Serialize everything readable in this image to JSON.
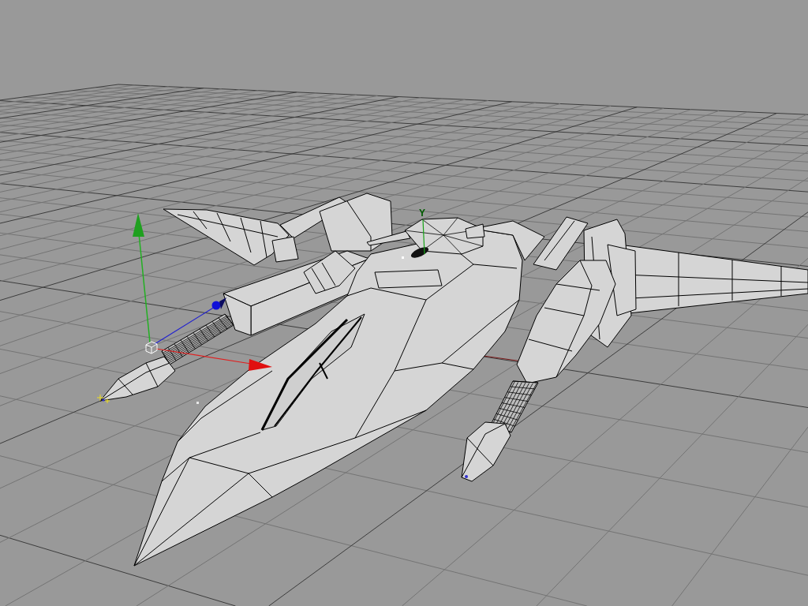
{
  "viewport": {
    "pivot_axis_label": "Y"
  }
}
